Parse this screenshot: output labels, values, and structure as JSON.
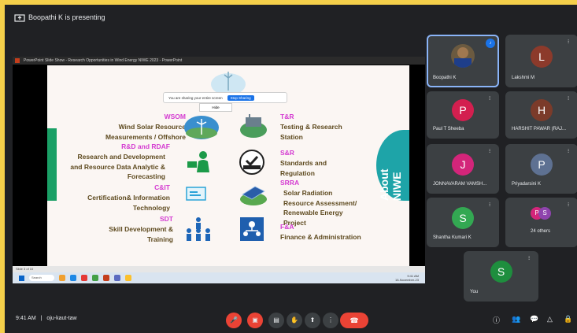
{
  "header": {
    "presenting_text": "Boopathi K is presenting"
  },
  "share": {
    "ppt_title": "PowerPoint Slide Show - Research Opportunities in Wind Energy NIWE 2023 - PowerPoint",
    "banner_text": "You are sharing your entire screen",
    "stop_label": "Stop Sharing",
    "banner_sub": "Hide",
    "status_text": "Slide 3 of 10",
    "taskbar_search": "Search",
    "taskbar_time": "9:41 AM",
    "taskbar_date": "15-November-23"
  },
  "slide": {
    "left": [
      {
        "code": "WSOM",
        "desc": [
          "Wind Solar Resource",
          "Measurements / Offshore"
        ],
        "icon": "wind-turbine-icon"
      },
      {
        "code": "R&D and RDAF",
        "desc": [
          "Research and Development",
          "and Resource Data Analytic &",
          "Forecasting"
        ],
        "icon": "researcher-icon"
      },
      {
        "code": "C&IT",
        "desc": [
          "Certification& Information",
          "Technology"
        ],
        "icon": "certificate-screen-icon"
      },
      {
        "code": "SDT",
        "desc": [
          "Skill Development &",
          "Training"
        ],
        "icon": "training-group-icon"
      }
    ],
    "right": [
      {
        "code": "T&R",
        "desc": [
          "Testing & Research",
          "Station"
        ],
        "icon": "test-station-icon"
      },
      {
        "code": "S&R",
        "desc": [
          "Standards and",
          "Regulation"
        ],
        "icon": "certified-badge-icon"
      },
      {
        "code": "SRRA",
        "desc": [
          "Solar Radiation",
          "Resource Assessment/",
          "Renewable Energy",
          "Project"
        ],
        "icon": "solar-panel-icon"
      },
      {
        "code": "F&A",
        "desc": [
          "Finance & Administration"
        ],
        "icon": "finance-admin-icon"
      }
    ],
    "about_label": "About NIWE",
    "badge_text": "NIWE"
  },
  "participants": [
    {
      "name": "Boopathi K",
      "initial": "",
      "color": "#5f6368",
      "active": true,
      "photo": true
    },
    {
      "name": "Lakshmi M",
      "initial": "L",
      "color": "#8c3a2b"
    },
    {
      "name": "Paul T Sheeba",
      "initial": "P",
      "color": "#d31f4f"
    },
    {
      "name": "HARSHIT PAWAR (RAJ...",
      "initial": "H",
      "color": "#7b3b2a"
    },
    {
      "name": "JONNAVARAM VAMSH...",
      "initial": "J",
      "color": "#d3257a"
    },
    {
      "name": "Priyadarsini K",
      "initial": "P",
      "color": "#5e7192"
    },
    {
      "name": "Shantha Kumari K",
      "initial": "S",
      "color": "#33a852"
    },
    {
      "name": "24 others",
      "initial": "",
      "color": "#3c4043",
      "others": true
    },
    {
      "name": "You",
      "initial": "S",
      "color": "#1e8e3e"
    }
  ],
  "footer": {
    "time": "9:41 AM",
    "separator": "|",
    "meeting_code": "oju-kaut-taw"
  },
  "colors": {
    "accent": "#1a73e8",
    "danger": "#ea4335",
    "slide_code": "#d43bd1",
    "slide_text": "#5e4a1f"
  }
}
